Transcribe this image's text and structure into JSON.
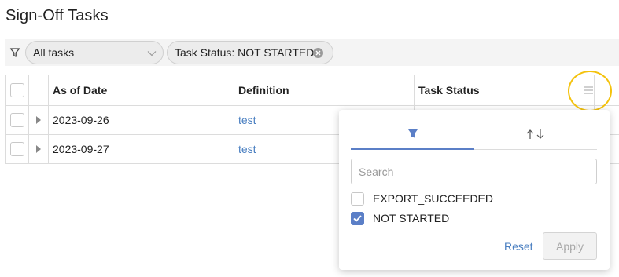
{
  "page": {
    "title": "Sign-Off Tasks"
  },
  "filter_bar": {
    "icon": "filter-icon",
    "task_select_value": "All tasks",
    "status_chip_label": "Task Status: NOT STARTED"
  },
  "grid": {
    "columns": {
      "as_of_date": "As of Date",
      "definition": "Definition",
      "task_status": "Task Status"
    },
    "rows": [
      {
        "as_of_date": "2023-09-26",
        "definition": "test"
      },
      {
        "as_of_date": "2023-09-27",
        "definition": "test"
      }
    ]
  },
  "column_menu": {
    "icon": "menu-icon",
    "highlight_color": "#f4c20d",
    "tabs": {
      "filter_icon": "filter-icon",
      "sort_icon": "sort-icon"
    },
    "search_placeholder": "Search",
    "options": [
      {
        "label": "EXPORT_SUCCEEDED",
        "checked": false
      },
      {
        "label": "NOT STARTED",
        "checked": true
      }
    ],
    "reset_label": "Reset",
    "apply_label": "Apply"
  },
  "colors": {
    "accent": "#5b7fc7",
    "link": "#4a7fc1"
  }
}
